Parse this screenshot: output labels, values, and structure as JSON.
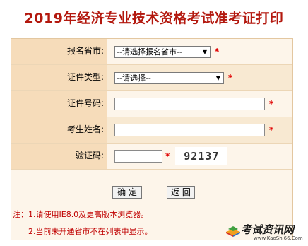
{
  "page": {
    "title": "2019年经济专业技术资格考试准考证打印"
  },
  "form": {
    "province": {
      "label": "报名省市:",
      "selected": "--请选择报名省市--",
      "required_mark": "*"
    },
    "id_type": {
      "label": "证件类型:",
      "selected": "--请选择--",
      "required_mark": "*"
    },
    "id_number": {
      "label": "证件号码:",
      "value": "",
      "required_mark": "*"
    },
    "name": {
      "label": "考生姓名:",
      "value": "",
      "required_mark": "*"
    },
    "captcha": {
      "label": "验证码:",
      "value": "",
      "required_mark": "*",
      "image_text": "92137"
    }
  },
  "buttons": {
    "confirm_label": "确 定",
    "back_label": "返 回"
  },
  "notes": {
    "line1": "注：1.请使用IE8.0及更高版本浏览器。",
    "line2": "2.当前未开通省市不在列表中显示。"
  },
  "watermark": {
    "brand": "考试资讯网",
    "url": "www.KaoShi66.Com"
  },
  "colors": {
    "title": "#b3180e",
    "label_bg": "#f6dcba",
    "row_bg": "#fdf5ea",
    "required": "#e00000",
    "note": "#c00000"
  }
}
